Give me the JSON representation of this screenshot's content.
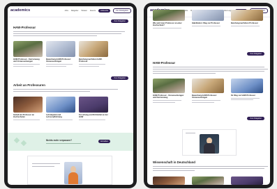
{
  "brand": {
    "logo": "academics"
  },
  "nav": {
    "links": [
      "Jobs",
      "Ratgeber",
      "Wissen",
      "Events"
    ],
    "primary_button": "Jobsuche",
    "secondary_button": "Für Arbeitgeber",
    "employer_link": "Arbeitgeber-Login"
  },
  "left": {
    "section1_title": "HAW-Professur",
    "section1_cards": [
      {
        "title": "HAW-Professur - Karriereweg und Voraussetzungen",
        "img": "ph-room"
      },
      {
        "title": "Bewerbung HAW-Professur: Voraussetzungen",
        "img": "ph-lab"
      },
      {
        "title": "Berufungsverfahren HAW-Professur",
        "img": "ph-box"
      }
    ],
    "section1_cta": "Zum Ratgeber",
    "section2_title": "Arbeit an Professuren",
    "section2_cards": [
      {
        "title": "Gehalt als Professor an Hochschulen",
        "img": "ph-dark"
      },
      {
        "title": "Lehrdeputat und Lehrverpflichtung",
        "img": "ph-blue"
      },
      {
        "title": "Forschung und Drittmittel an der HAW",
        "img": "ph-purple"
      }
    ],
    "section2_cta": "Zum Ratgeber",
    "band_title": "Nichts mehr verpassen?",
    "band_button": "Anmelden"
  },
  "right": {
    "top_cards": [
      {
        "title": "Wie wird man Professor an einer Hochschule?",
        "img": "ph-room"
      },
      {
        "title": "Habilitation: Weg zur Professur",
        "img": "ph-lab"
      },
      {
        "title": "Berufungsverfahren Professur",
        "img": "ph-box"
      }
    ],
    "top_cta": "Zum Ratgeber",
    "section_title": "HAW-Professur",
    "section_cards": [
      {
        "title": "HAW-Professur - Voraussetzungen und Karriereweg",
        "img": "ph-room"
      },
      {
        "title": "Bewerbung HAW-Professur: Voraussetzungen",
        "img": "ph-box"
      },
      {
        "title": "Ihr Weg zur HAW-Professur",
        "img": "ph-blue"
      }
    ],
    "section_cta": "Zum Ratgeber",
    "section3_title": "Wissenschaft in Deutschland"
  }
}
